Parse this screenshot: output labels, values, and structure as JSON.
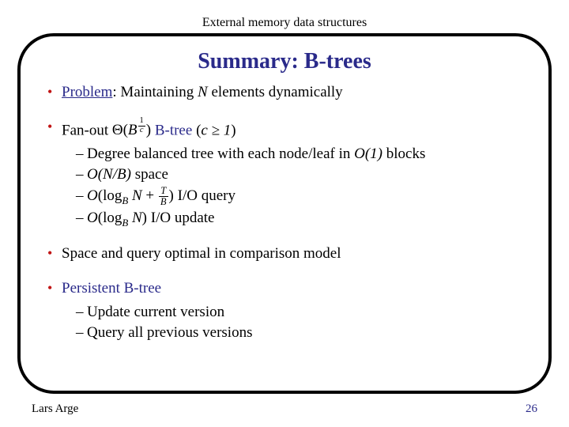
{
  "header": "External memory data structures",
  "title": "Summary: B-trees",
  "bullets": {
    "problem_label": "Problem",
    "problem_text": ": Maintaining ",
    "N": "N",
    "problem_tail": " elements dynamically",
    "fanout_lead": "Fan-out ",
    "fanout_btree": " B-tree ",
    "sub_degree_a": "Degree balanced tree with each node/leaf in ",
    "O1": "O(1)",
    "sub_degree_b": " blocks",
    "sub_space_a": "O(N/B)",
    "sub_space_b": " space",
    "sub_query": " I/O query",
    "sub_update": " I/O update",
    "optimal": "Space and query optimal in comparison model",
    "persistent": "Persistent B-tree",
    "per_update": "Update current version",
    "per_query": "Query all previous versions"
  },
  "math": {
    "theta": "Θ",
    "open": "(",
    "close": ")",
    "B": "B",
    "exp_n": "1",
    "exp_d": "c",
    "cge1": "c ≥ 1",
    "O": "O",
    "logB": "log",
    "logBsub": "B",
    "N2": "N",
    "plus": " + ",
    "T": "T",
    "slashB": "B",
    "N3": "N"
  },
  "footer": {
    "author": "Lars Arge",
    "page": "26"
  }
}
